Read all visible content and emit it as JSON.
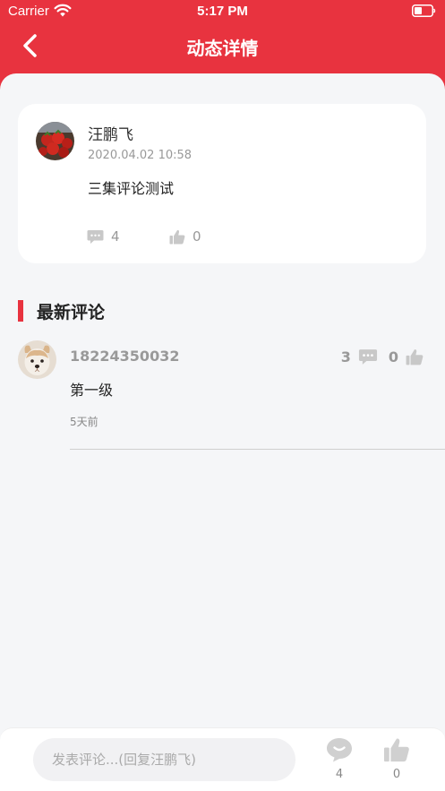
{
  "status_bar": {
    "carrier": "Carrier",
    "time": "5:17 PM"
  },
  "nav": {
    "title": "动态详情"
  },
  "post": {
    "author": "汪鹏飞",
    "date": "2020.04.02 10:58",
    "text": "三集评论测试",
    "comment_count": "4",
    "like_count": "0"
  },
  "section": {
    "title": "最新评论"
  },
  "comments": [
    {
      "user": "18224350032",
      "text": "第一级",
      "time": "5天前",
      "reply_count": "3",
      "like_count": "0"
    }
  ],
  "bottom_bar": {
    "placeholder": "发表评论...(回复汪鹏飞)",
    "comment_count": "4",
    "like_count": "0"
  },
  "colors": {
    "accent": "#e8333f",
    "background": "#f5f6f8"
  }
}
